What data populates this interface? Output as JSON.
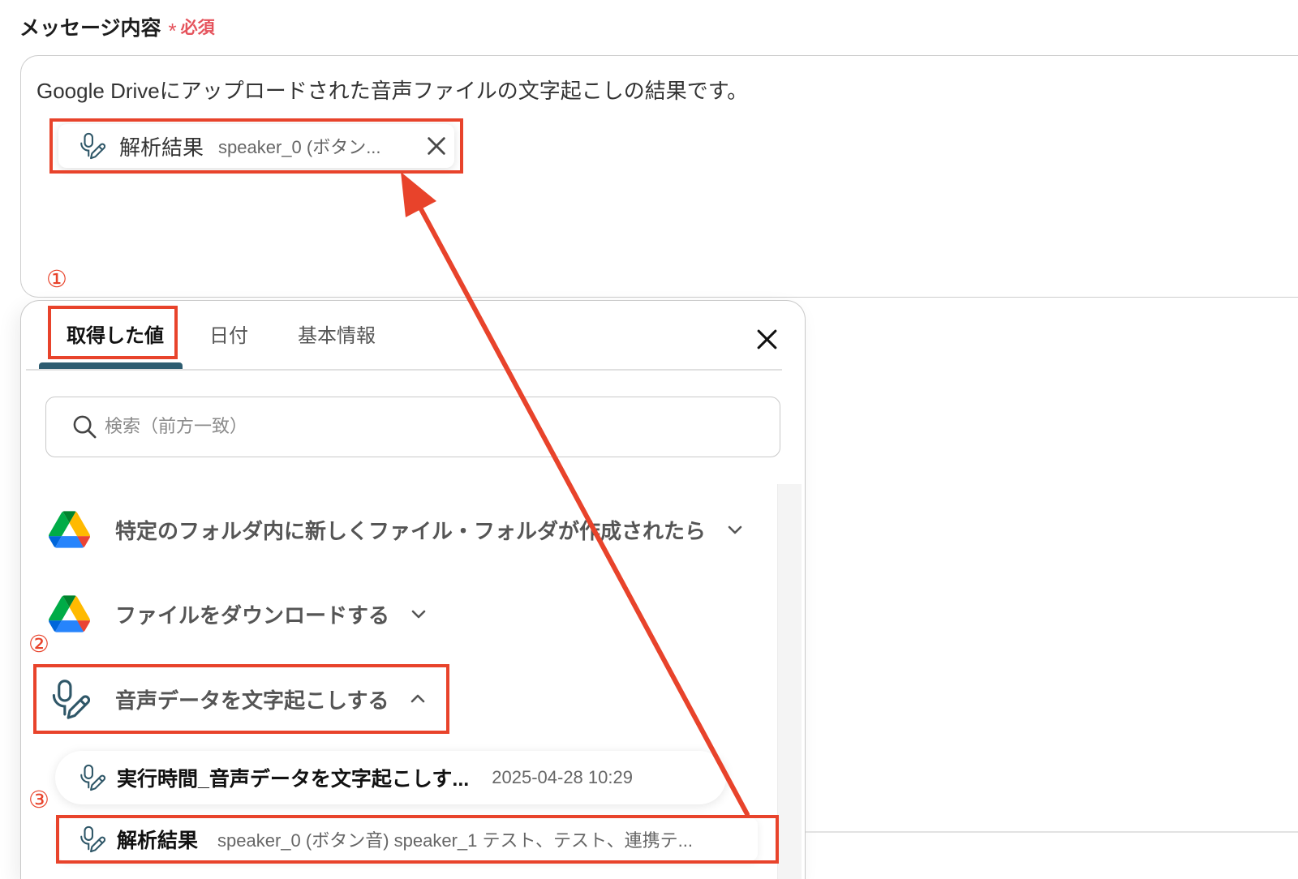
{
  "form": {
    "label": "メッセージ内容",
    "required_mark": "*",
    "required_text": "必須",
    "message_text": "Google Driveにアップロードされた音声ファイルの文字起こしの結果です。",
    "chip": {
      "icon": "mic-pencil-icon",
      "label": "解析結果",
      "value": "speaker_0 (ボタン...",
      "remove_icon": "close-icon"
    }
  },
  "annotations": {
    "step1": "①",
    "step2": "②",
    "step3": "③"
  },
  "picker": {
    "tabs": [
      {
        "label": "取得した値",
        "active": true
      },
      {
        "label": "日付",
        "active": false
      },
      {
        "label": "基本情報",
        "active": false
      }
    ],
    "close_icon": "close-icon",
    "search": {
      "placeholder": "検索（前方一致）",
      "icon": "search-icon"
    },
    "groups": [
      {
        "icon": "google-drive-icon",
        "title": "特定のフォルダ内に新しくファイル・フォルダが作成されたら",
        "expanded": false
      },
      {
        "icon": "google-drive-icon",
        "title": "ファイルをダウンロードする",
        "expanded": false
      },
      {
        "icon": "mic-pencil-icon",
        "title": "音声データを文字起こしする",
        "expanded": true,
        "items": [
          {
            "icon": "mic-pencil-icon",
            "label": "実行時間_音声データを文字起こしす...",
            "value": "2025-04-28 10:29"
          },
          {
            "icon": "mic-pencil-icon",
            "label": "解析結果",
            "value": "speaker_0 (ボタン音) speaker_1 テスト、テスト、連携テ..."
          }
        ]
      }
    ]
  },
  "colors": {
    "annotation": "#e8432b",
    "accent": "#2d5c70",
    "required": "#e5535c",
    "icon": "#2f5768"
  }
}
